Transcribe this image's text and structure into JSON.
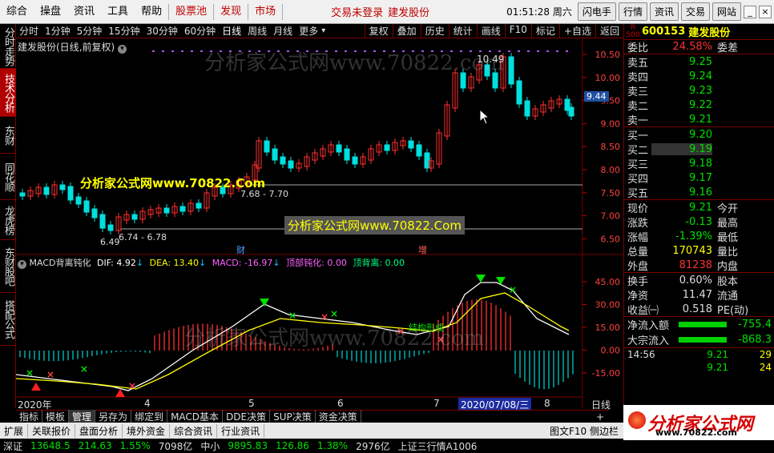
{
  "menubar": {
    "items": [
      "综合",
      "操盘",
      "资讯",
      "工具",
      "帮助",
      "股票池",
      "发现",
      "市场"
    ],
    "status_login": "交易未登录",
    "status_stock": "建发股份",
    "clock": "01:51:28",
    "weekday": "周六",
    "right_buttons": [
      "闪电手",
      "行情",
      "资讯",
      "交易",
      "网站"
    ]
  },
  "left_tabs": [
    {
      "label": "分时走势",
      "active": false
    },
    {
      "label": "技术分析",
      "active": true
    },
    {
      "label": "东财",
      "active": false
    },
    {
      "label": "同花顺",
      "active": false
    },
    {
      "label": "龙虎榜",
      "active": false
    },
    {
      "label": "东财股吧",
      "active": false
    },
    {
      "label": "搭配公式",
      "active": false
    }
  ],
  "period": {
    "items": [
      "分时",
      "1分钟",
      "5分钟",
      "15分钟",
      "30分钟",
      "60分钟",
      "日线",
      "周线",
      "月线",
      "更多"
    ],
    "active": "日线",
    "tools": [
      "复权",
      "叠加",
      "历史",
      "统计",
      "画线",
      "F10",
      "标记",
      "+自选",
      "返回"
    ]
  },
  "main_chart": {
    "title": "建发股份(日线,前复权)",
    "y_ticks": [
      "10.50",
      "10.00",
      "9.50",
      "9.00",
      "8.50",
      "8.00",
      "7.50",
      "7.00",
      "6.50"
    ],
    "price_tag": "9.44",
    "high_label": "10.49",
    "low_label": "6.49",
    "range1": "7.68 - 7.70",
    "range2": "6.74 - 6.78",
    "marker_cai": "财",
    "marker_zeng": "增"
  },
  "macd": {
    "name": "MACD背离钝化",
    "dif": "DIF: 4.92",
    "dea": "DEA: 13.40",
    "macd": "MACD: -16.97",
    "top_dunhua": "顶部钝化: 0.00",
    "top_beili": "顶背离: 0.00",
    "y_ticks": [
      "45.00",
      "30.00",
      "15.00",
      "0.00",
      "-15.00"
    ],
    "annotation": "结构形成",
    "colors": {
      "dif": "#ffffff",
      "dea": "#ffff00",
      "macd_label": "#ff00ff",
      "pos_bar": "#ff3030",
      "neg_bar": "#00c8c8"
    }
  },
  "x_axis": {
    "labels": [
      "2020年",
      "4",
      "5",
      "6",
      "7",
      "8"
    ],
    "current_date": "2020/07/08/三",
    "period_label": "日线"
  },
  "watermark": "分析家公式网www.70822.com",
  "ad1": "分析家公式网www.70822.Com",
  "ad2": "分析家公式网www.70822.Com",
  "quote": {
    "r_label": "R",
    "r_num": "500",
    "code": "600153",
    "name": "建发股份",
    "weibi": {
      "label": "委比",
      "value": "24.58%",
      "label2": "委差"
    },
    "asks": [
      {
        "label": "卖五",
        "price": "9.25"
      },
      {
        "label": "卖四",
        "price": "9.24"
      },
      {
        "label": "卖三",
        "price": "9.23"
      },
      {
        "label": "卖二",
        "price": "9.22"
      },
      {
        "label": "卖一",
        "price": "9.21"
      }
    ],
    "bids": [
      {
        "label": "买一",
        "price": "9.20"
      },
      {
        "label": "买二",
        "price": "9.19"
      },
      {
        "label": "买三",
        "price": "9.18"
      },
      {
        "label": "买四",
        "price": "9.17"
      },
      {
        "label": "买五",
        "price": "9.16"
      }
    ],
    "stats": [
      {
        "l1": "现价",
        "v1": "9.21",
        "l2": "今开"
      },
      {
        "l1": "涨跌",
        "v1": "-0.13",
        "l2": "最高"
      },
      {
        "l1": "涨幅",
        "v1": "-1.39%",
        "l2": "最低"
      },
      {
        "l1": "总量",
        "v1": "170743",
        "l2": "量比"
      },
      {
        "l1": "外盘",
        "v1": "81238",
        "l2": "内盘"
      }
    ],
    "stats2": [
      {
        "l1": "换手",
        "v1": "0.60%",
        "l2": "股本"
      },
      {
        "l1": "净资",
        "v1": "11.47",
        "l2": "流通"
      },
      {
        "l1": "收益㈠",
        "v1": "0.518",
        "l2": "PE(动)"
      }
    ],
    "flows": [
      {
        "label": "净流入额",
        "value": "-755.4"
      },
      {
        "label": "大宗流入",
        "value": "-868.3"
      }
    ],
    "ticks": [
      {
        "time": "14:56",
        "price": "9.21",
        "vol": "29"
      },
      {
        "time": "",
        "price": "9.21",
        "vol": "24"
      }
    ]
  },
  "bottom_tabs": [
    "指标",
    "模板",
    "管理",
    "另存为",
    "绑定到",
    "MACD基本",
    "DDE决策",
    "SUP决策",
    "资金决策"
  ],
  "bottom_active": "管理",
  "bottom_bar2": [
    "扩展",
    "关联报价",
    "盘面分析",
    "境外资金",
    "综合资讯",
    "行业资讯"
  ],
  "bottom_bar2_right": "图文F10 侧边栏",
  "bottom_bar3": {
    "a": "深证",
    "b": "13648.5",
    "c": "214.63",
    "d": "1.55%",
    "e": "7098亿",
    "f": "中小",
    "g": "9895.83",
    "h": "126.86",
    "i": "1.38%",
    "j": "2976亿",
    "k": "上证三行情A1006"
  },
  "logo": {
    "text": "分析家公式网",
    "url": "www.70822.com"
  }
}
